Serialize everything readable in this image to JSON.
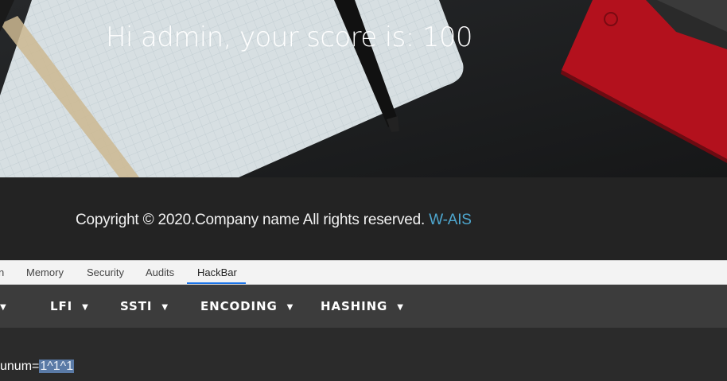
{
  "hero": {
    "title": "Hi admin, your score is: 100"
  },
  "footer": {
    "copyright_text": "Copyright © 2020.Company name All rights reserved.",
    "link_text": "W-AIS",
    "link_color": "#4ea7cf"
  },
  "devtools": {
    "tabs": [
      "n",
      "Memory",
      "Security",
      "Audits",
      "HackBar"
    ],
    "active_tab": "HackBar",
    "accent_color": "#1a73e8"
  },
  "hackbar": {
    "menu": [
      {
        "label": "",
        "icon": "caret-down-icon"
      },
      {
        "label": "LFI",
        "icon": "caret-down-icon"
      },
      {
        "label": "SSTI",
        "icon": "caret-down-icon"
      },
      {
        "label": "ENCODING",
        "icon": "caret-down-icon"
      },
      {
        "label": "HASHING",
        "icon": "caret-down-icon"
      }
    ],
    "url_prefix": "unum=",
    "url_selected": "1^1^1",
    "selection_color": "#5a7aa6"
  }
}
